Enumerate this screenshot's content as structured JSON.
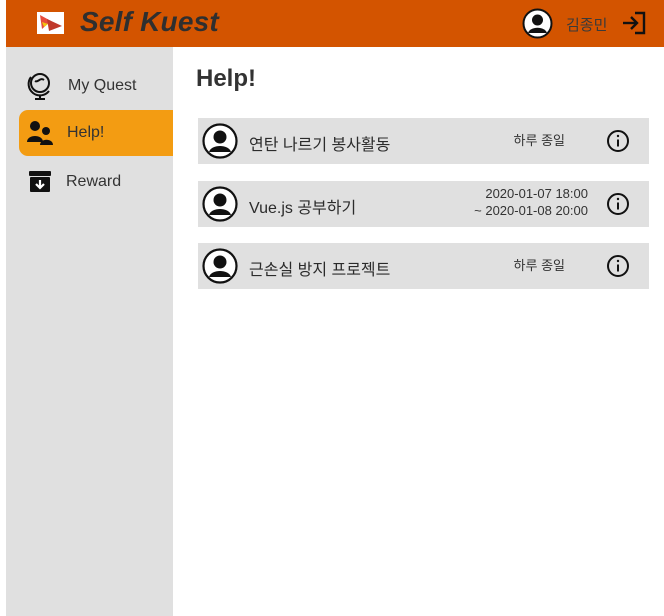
{
  "header": {
    "app_title": "Self Kuest",
    "user_name": "김종민"
  },
  "sidebar": {
    "items": [
      {
        "label": "My Quest",
        "icon": "globe-icon",
        "active": false
      },
      {
        "label": "Help!",
        "icon": "users-icon",
        "active": true
      },
      {
        "label": "Reward",
        "icon": "archive-icon",
        "active": false
      }
    ]
  },
  "main": {
    "title": "Help!",
    "quests": [
      {
        "title": "연탄 나르기 봉사활동",
        "date_line1": "하루 종일",
        "date_line2": ""
      },
      {
        "title": "Vue.js 공부하기",
        "date_line1": "2020-01-07 18:00",
        "date_line2": "~ 2020-01-08 20:00"
      },
      {
        "title": "근손실 방지 프로젝트",
        "date_line1": "하루 종일",
        "date_line2": ""
      }
    ]
  },
  "colors": {
    "header": "#d35400",
    "active_nav": "#f39c12",
    "sidebar": "#e0e0e0",
    "row": "#e0e0e0"
  }
}
